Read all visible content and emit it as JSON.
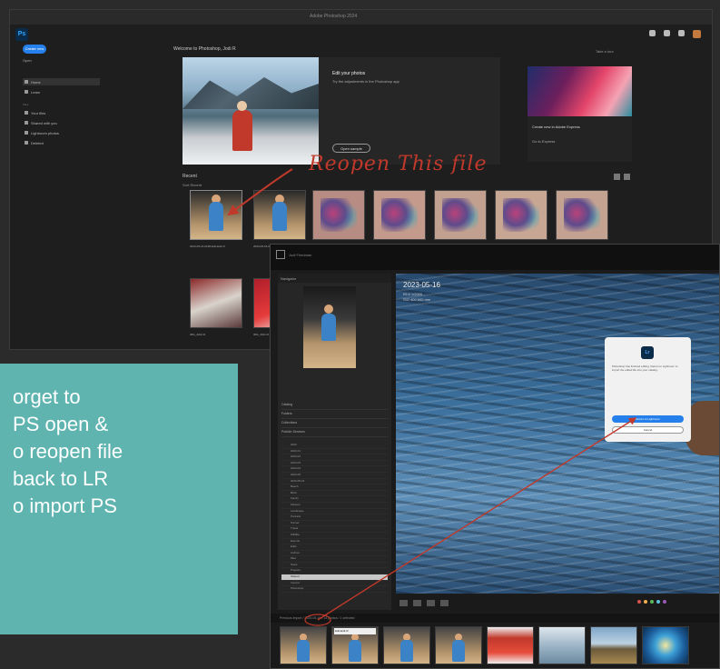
{
  "ps": {
    "logo": "Ps",
    "create_label": "Create new",
    "open_label": "Open",
    "sidebar": [
      {
        "label": "Home",
        "active": true
      },
      {
        "label": "Learn",
        "active": false
      }
    ],
    "sidebar_head": "Files",
    "sidebar_files": [
      "Your files",
      "Shared with you",
      "Lightroom photos",
      "Deleted"
    ],
    "welcome": "Welcome to Photoshop, Jodi R",
    "tour_link": "Take a tour",
    "hero_title": "Edit your photos",
    "hero_sub": "Try the adjustments in the Photoshop app",
    "hero_button": "Open sample",
    "promo_title": "Create new in Adobe Express",
    "promo_link": "Go to Express",
    "recent_label": "Recent",
    "sort_label": "Sort  Recent",
    "captions": [
      "2023-05-16-0198-Edit-Edit.tif",
      "2023-05-16-0198-Edit.tif",
      "2023-05-16-0192.tif",
      "2023-05-16-0192-2.tif",
      "2023-05-16-0188.tif",
      "2023-05-16-0185.tif",
      "2023-05-16-0180.tif",
      "IMG_4012.tif",
      "IMG_4011.tif"
    ]
  },
  "annotation": "Reopen This file",
  "callout": {
    "lines": [
      "orget to",
      "PS open &",
      "o reopen file",
      "back to LR",
      "o import PS"
    ]
  },
  "lr": {
    "identity": "Jodi Friedman",
    "navigator": "Navigator",
    "panels": [
      "Catalog",
      "Folders",
      "Collections",
      "Publish Services"
    ],
    "folders": [
      "2023",
      "2023-01",
      "2023-02",
      "2023-03",
      "2023-04",
      "2023-05",
      "2023-05-16",
      "Beach",
      "Birds",
      "Family",
      "Flowers",
      "Landscape",
      "Portraits",
      "Sunset",
      "Travel",
      "Wildlife",
      "Exports",
      "Edits",
      "Archive",
      "Misc",
      "Stock",
      "Projects",
      "Shared",
      "Imports",
      "Photoshop"
    ],
    "selected_folder_index": 22,
    "image_title": "2023-05-16",
    "image_sub": "f/5.6  1/2000",
    "image_meta": "ISO 400  600 mm",
    "dialog_badge": "Lr",
    "dialog_message": "Photoshop has finished editing. Return to Lightroom to import the edited file into your catalog.",
    "dialog_primary": "Return to Lightroom",
    "dialog_secondary": "Cancel",
    "filmbar": "Previous Import  /  2023-05-16  /  14 photos / 1 selected",
    "film_tip": "Edit-Edit.tif"
  }
}
